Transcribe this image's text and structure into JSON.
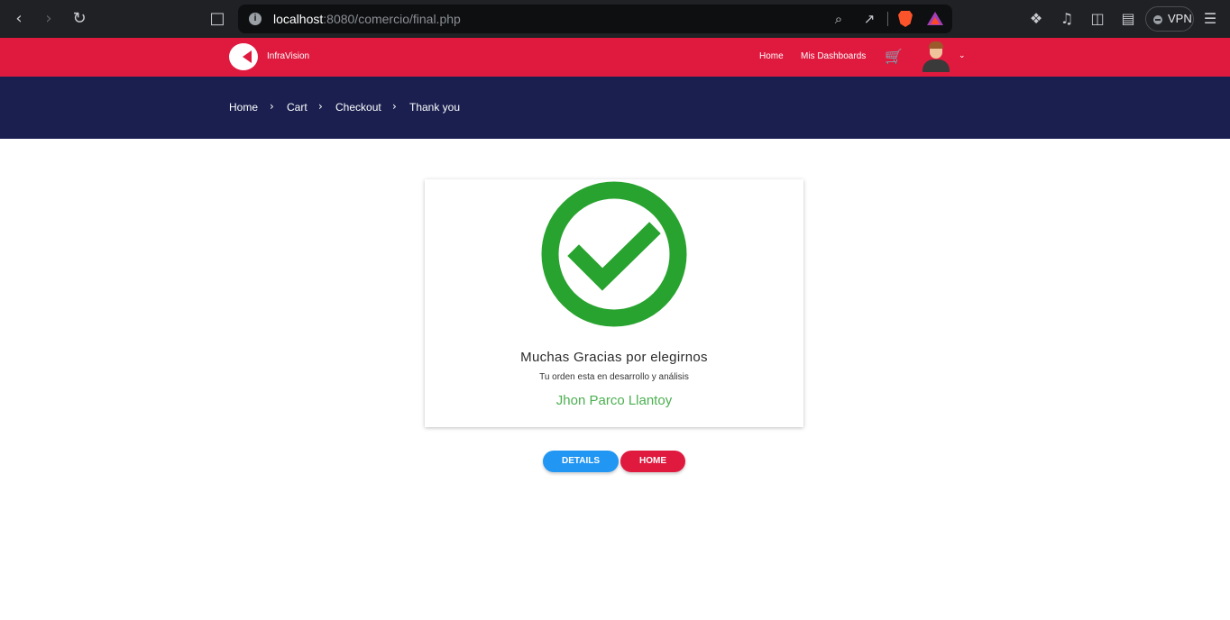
{
  "browser": {
    "url_host": "localhost",
    "url_rest": ":8080/comercio/final.php",
    "vpn_label": "VPN"
  },
  "navbar": {
    "brand": "InfraVision",
    "links": [
      "Home",
      "Mis Dashboards"
    ]
  },
  "breadcrumb": [
    "Home",
    "Cart",
    "Checkout",
    "Thank you"
  ],
  "confirmation": {
    "title": "Muchas Gracias por elegirnos",
    "subtitle": "Tu orden esta en desarrollo y análisis",
    "customer_name": "Jhon Parco Llantoy"
  },
  "buttons": {
    "details": "DETAILS",
    "home": "HOME"
  },
  "colors": {
    "navbar": "#e01a3f",
    "breadcrumb_band": "#1a1f4f",
    "success": "#28a32f",
    "details_button": "#2196f3",
    "home_button": "#e01a3f",
    "customer_name": "#4caf50"
  }
}
